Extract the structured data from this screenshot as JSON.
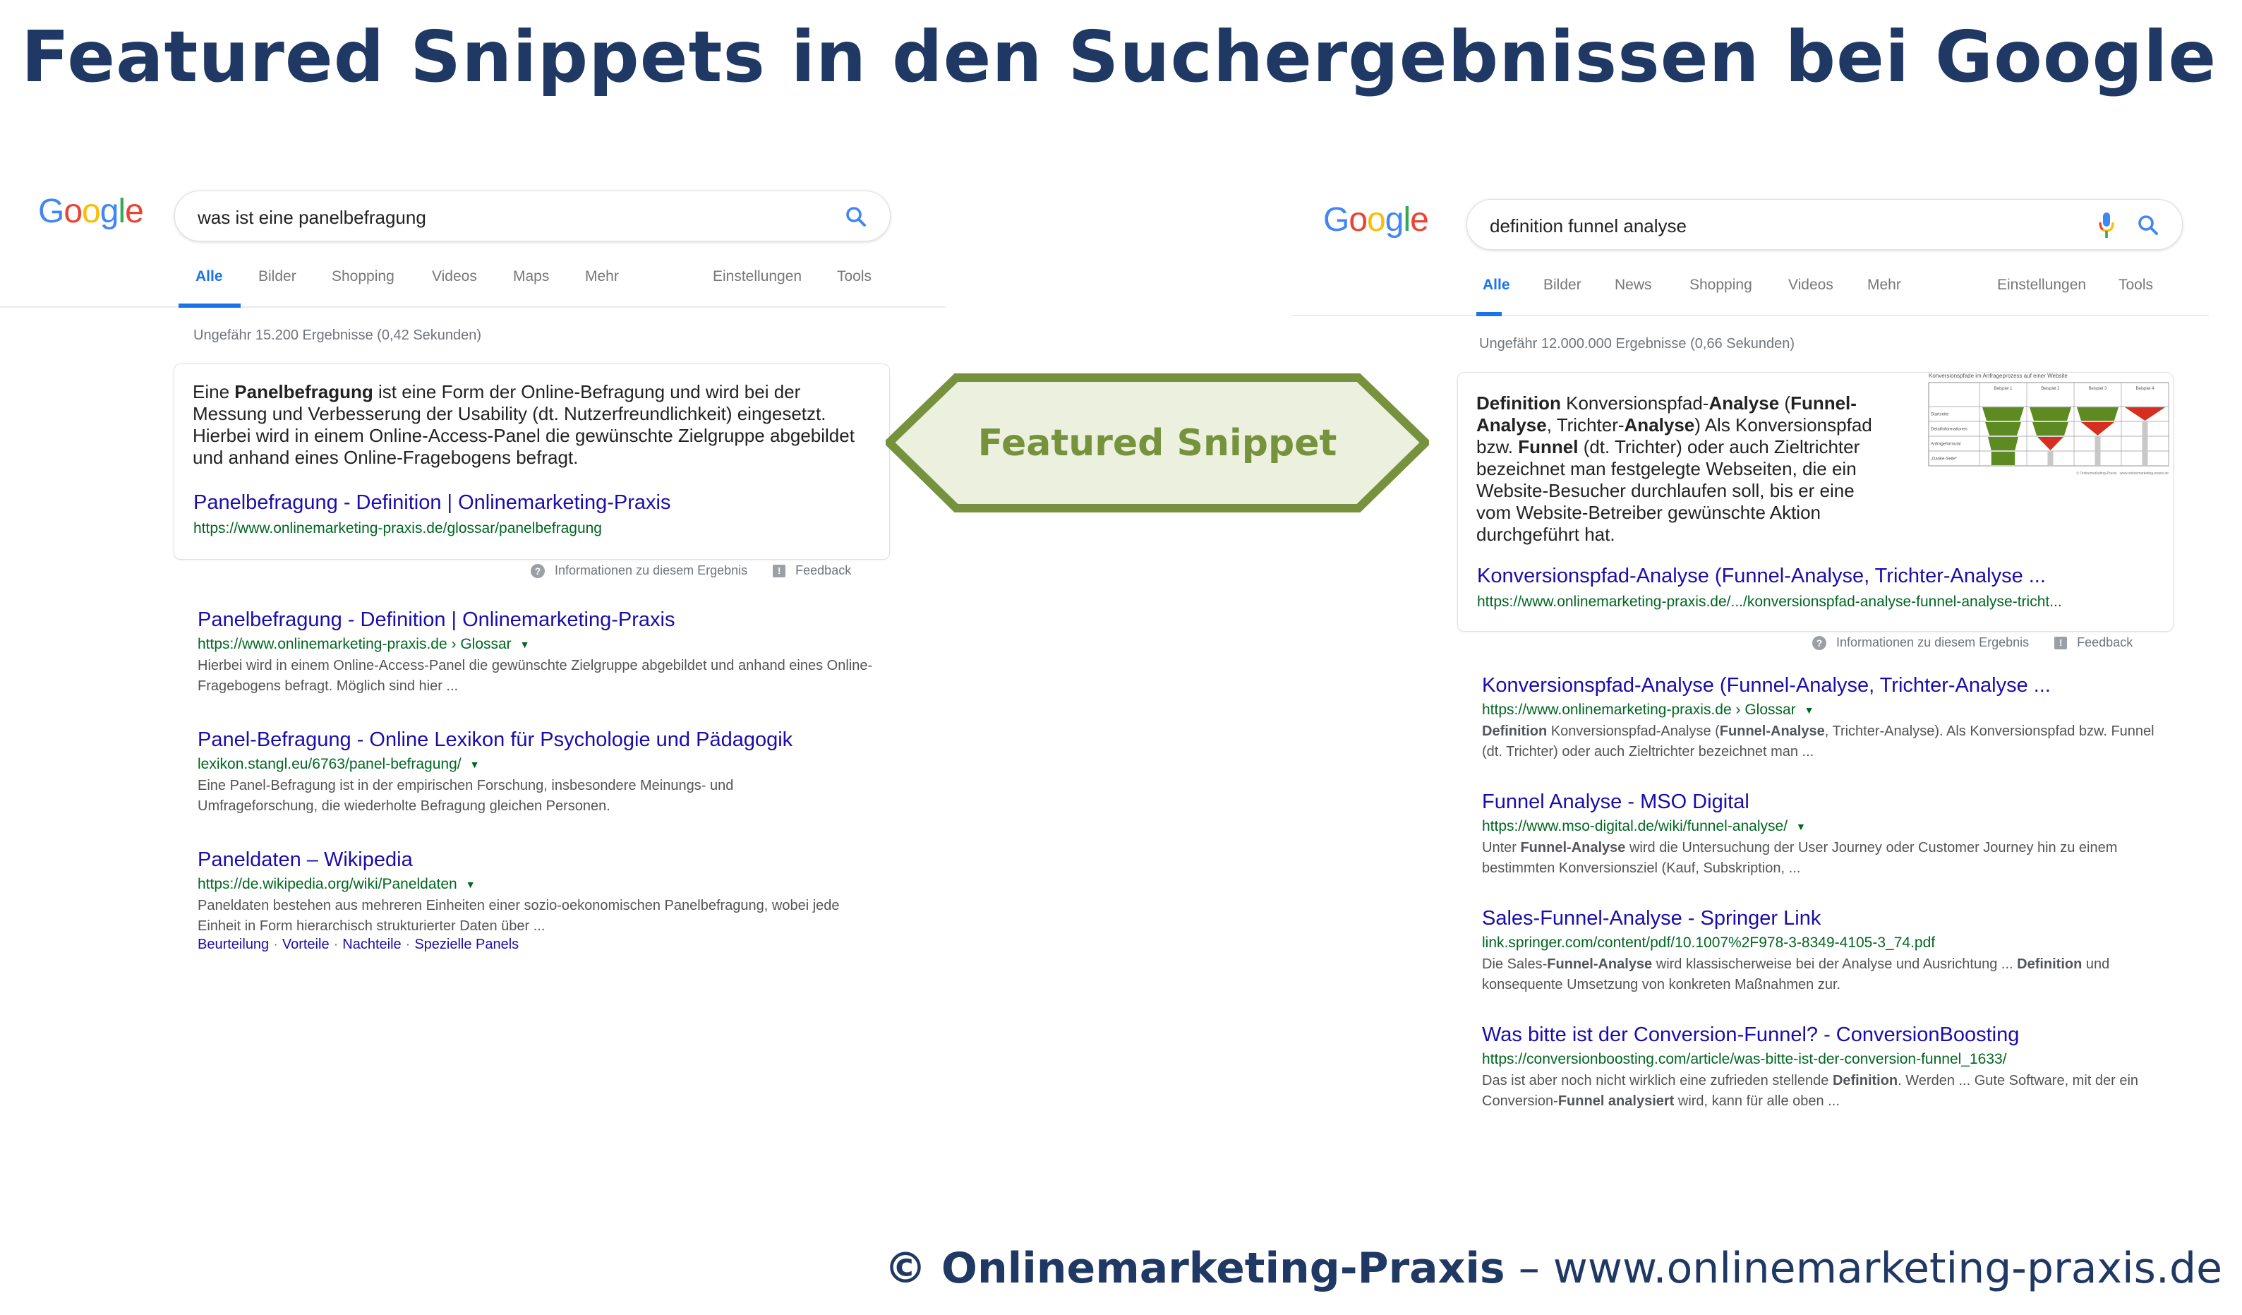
{
  "page_title": "Featured Snippets in den Suchergebnissen bei Google",
  "colors": {
    "title": "#1f3864",
    "badge_border": "#76923c",
    "badge_fill": "#ebf1de",
    "link": "#1a0dab",
    "url": "#006621",
    "tab_active": "#1a73e8",
    "funnel_green": "#5e8a22",
    "funnel_red": "#d62e1f"
  },
  "badge": {
    "label": "Featured Snippet"
  },
  "footer": {
    "brand": "© Onlinemarketing-Praxis",
    "dash": " – ",
    "url": "www.onlinemarketing-praxis.de"
  },
  "left": {
    "logo": [
      "G",
      "o",
      "o",
      "g",
      "l",
      "e"
    ],
    "query": "was ist eine panelbefragung",
    "tabs": [
      "Alle",
      "Bilder",
      "Shopping",
      "Videos",
      "Maps",
      "Mehr"
    ],
    "tabs_right": [
      "Einstellungen",
      "Tools"
    ],
    "active_tab": "Alle",
    "stats": "Ungefähr 15.200 Ergebnisse (0,42 Sekunden)",
    "snippet": {
      "text_pre": "Eine ",
      "text_bold": "Panelbefragung",
      "text_post": " ist eine Form der Online-Befragung und wird bei der Messung und Verbesserung der Usability (dt. Nutzerfreundlichkeit) eingesetzt. Hierbei wird in einem Online-Access-Panel die gewünschte Zielgruppe abgebildet und anhand eines Online-Fragebogens befragt.",
      "title": "Panelbefragung - Definition | Onlinemarketing-Praxis",
      "url": "https://www.onlinemarketing-praxis.de/glossar/panelbefragung"
    },
    "feedback": {
      "info": "Informationen zu diesem Ergebnis",
      "feedback": "Feedback"
    },
    "results": [
      {
        "title": "Panelbefragung - Definition | Onlinemarketing-Praxis",
        "url": "https://www.onlinemarketing-praxis.de › Glossar",
        "desc": "Hierbei wird in einem Online-Access-Panel die gewünschte Zielgruppe abgebildet und anhand eines Online-Fragebogens befragt. Möglich sind hier ..."
      },
      {
        "title": "Panel-Befragung - Online Lexikon für Psychologie und Pädagogik",
        "url": "lexikon.stangl.eu/6763/panel-befragung/",
        "desc": "Eine Panel-Befragung ist in der empirischen Forschung, insbesondere Meinungs- und Umfrageforschung, die wiederholte Befragung gleichen Personen."
      },
      {
        "title": "Paneldaten – Wikipedia",
        "url": "https://de.wikipedia.org/wiki/Paneldaten",
        "desc": "Paneldaten bestehen aus mehreren Einheiten einer sozio-oekonomischen Panelbefragung, wobei jede Einheit in Form hierarchisch strukturierter Daten über ...",
        "sitelinks": [
          "Beurteilung",
          "Vorteile",
          "Nachteile",
          "Spezielle Panels"
        ]
      }
    ]
  },
  "right": {
    "logo": [
      "G",
      "o",
      "o",
      "g",
      "l",
      "e"
    ],
    "query": "definition funnel analyse",
    "tabs": [
      "Alle",
      "Bilder",
      "News",
      "Shopping",
      "Videos",
      "Mehr"
    ],
    "tabs_right": [
      "Einstellungen",
      "Tools"
    ],
    "active_tab": "Alle",
    "stats": "Ungefähr 12.000.000 Ergebnisse (0,66 Sekunden)",
    "snippet": {
      "parts": [
        {
          "t": "Definition",
          "b": true
        },
        {
          "t": " Konversionspfad-",
          "b": false
        },
        {
          "t": "Analyse",
          "b": true
        },
        {
          "t": " (",
          "b": false
        },
        {
          "t": "Funnel-Analyse",
          "b": true
        },
        {
          "t": ", Trichter-",
          "b": false
        },
        {
          "t": "Analyse",
          "b": true
        },
        {
          "t": ") Als Konversionspfad bzw. ",
          "b": false
        },
        {
          "t": "Funnel",
          "b": true
        },
        {
          "t": " (dt. Trichter) oder auch Zieltrichter bezeichnet man festgelegte Webseiten, die ein Website-Besucher durchlaufen soll, bis er eine vom Website-Betreiber gewünschte Aktion durchgeführt hat.",
          "b": false
        }
      ],
      "title": "Konversionspfad-Analyse (Funnel-Analyse, Trichter-Analyse ...",
      "url": "https://www.onlinemarketing-praxis.de/.../konversionspfad-analyse-funnel-analyse-tricht...",
      "image": {
        "title": "Konversionspfade im Anfrageprozess auf einer Website",
        "columns": [
          "Beispiel 1",
          "Beispiel 2",
          "Beispiel 3",
          "Beispiel 4"
        ],
        "rows": [
          "Startseite",
          "Detailinformationen",
          "Anfrageformular",
          "„Danke-Seite“"
        ],
        "funnel_depth": [
          4,
          3,
          2,
          1
        ],
        "credit": "© Onlinemarketing-Praxis · www.onlinemarketing-praxis.de"
      }
    },
    "feedback": {
      "info": "Informationen zu diesem Ergebnis",
      "feedback": "Feedback"
    },
    "results": [
      {
        "title": "Konversionspfad-Analyse (Funnel-Analyse, Trichter-Analyse ...",
        "url": "https://www.onlinemarketing-praxis.de › Glossar",
        "caret": true,
        "desc_parts": [
          {
            "t": "Definition",
            "b": true
          },
          {
            "t": " Konversionspfad-Analyse (",
            "b": false
          },
          {
            "t": "Funnel-Analyse",
            "b": true
          },
          {
            "t": ", Trichter-Analyse). Als Konversionspfad bzw. Funnel (dt. Trichter) oder auch Zieltrichter bezeichnet man ...",
            "b": false
          }
        ]
      },
      {
        "title": "Funnel Analyse - MSO Digital",
        "url": "https://www.mso-digital.de/wiki/funnel-analyse/",
        "caret": true,
        "desc_parts": [
          {
            "t": "Unter ",
            "b": false
          },
          {
            "t": "Funnel-Analyse",
            "b": true
          },
          {
            "t": " wird die Untersuchung der User Journey oder Customer Journey hin zu einem bestimmten Konversionsziel (Kauf, Subskription, ...",
            "b": false
          }
        ]
      },
      {
        "title": "Sales-Funnel-Analyse - Springer Link",
        "url": "link.springer.com/content/pdf/10.1007%2F978-3-8349-4105-3_74.pdf",
        "caret": false,
        "desc_parts": [
          {
            "t": "Die Sales-",
            "b": false
          },
          {
            "t": "Funnel-Analyse",
            "b": true
          },
          {
            "t": " wird klassischerweise bei der Analyse und Ausrichtung ... ",
            "b": false
          },
          {
            "t": "Definition",
            "b": true
          },
          {
            "t": " und konsequente Umsetzung von konkreten Maßnahmen zur.",
            "b": false
          }
        ]
      },
      {
        "title": "Was bitte ist der Conversion-Funnel? - ConversionBoosting",
        "url": "https://conversionboosting.com/article/was-bitte-ist-der-conversion-funnel_1633/",
        "caret": false,
        "desc_parts": [
          {
            "t": "Das ist aber noch nicht wirklich eine zufrieden stellende ",
            "b": false
          },
          {
            "t": "Definition",
            "b": true
          },
          {
            "t": ". Werden ... Gute Software, mit der ein Conversion-",
            "b": false
          },
          {
            "t": "Funnel analysiert",
            "b": true
          },
          {
            "t": " wird, kann für alle oben ...",
            "b": false
          }
        ]
      }
    ]
  }
}
